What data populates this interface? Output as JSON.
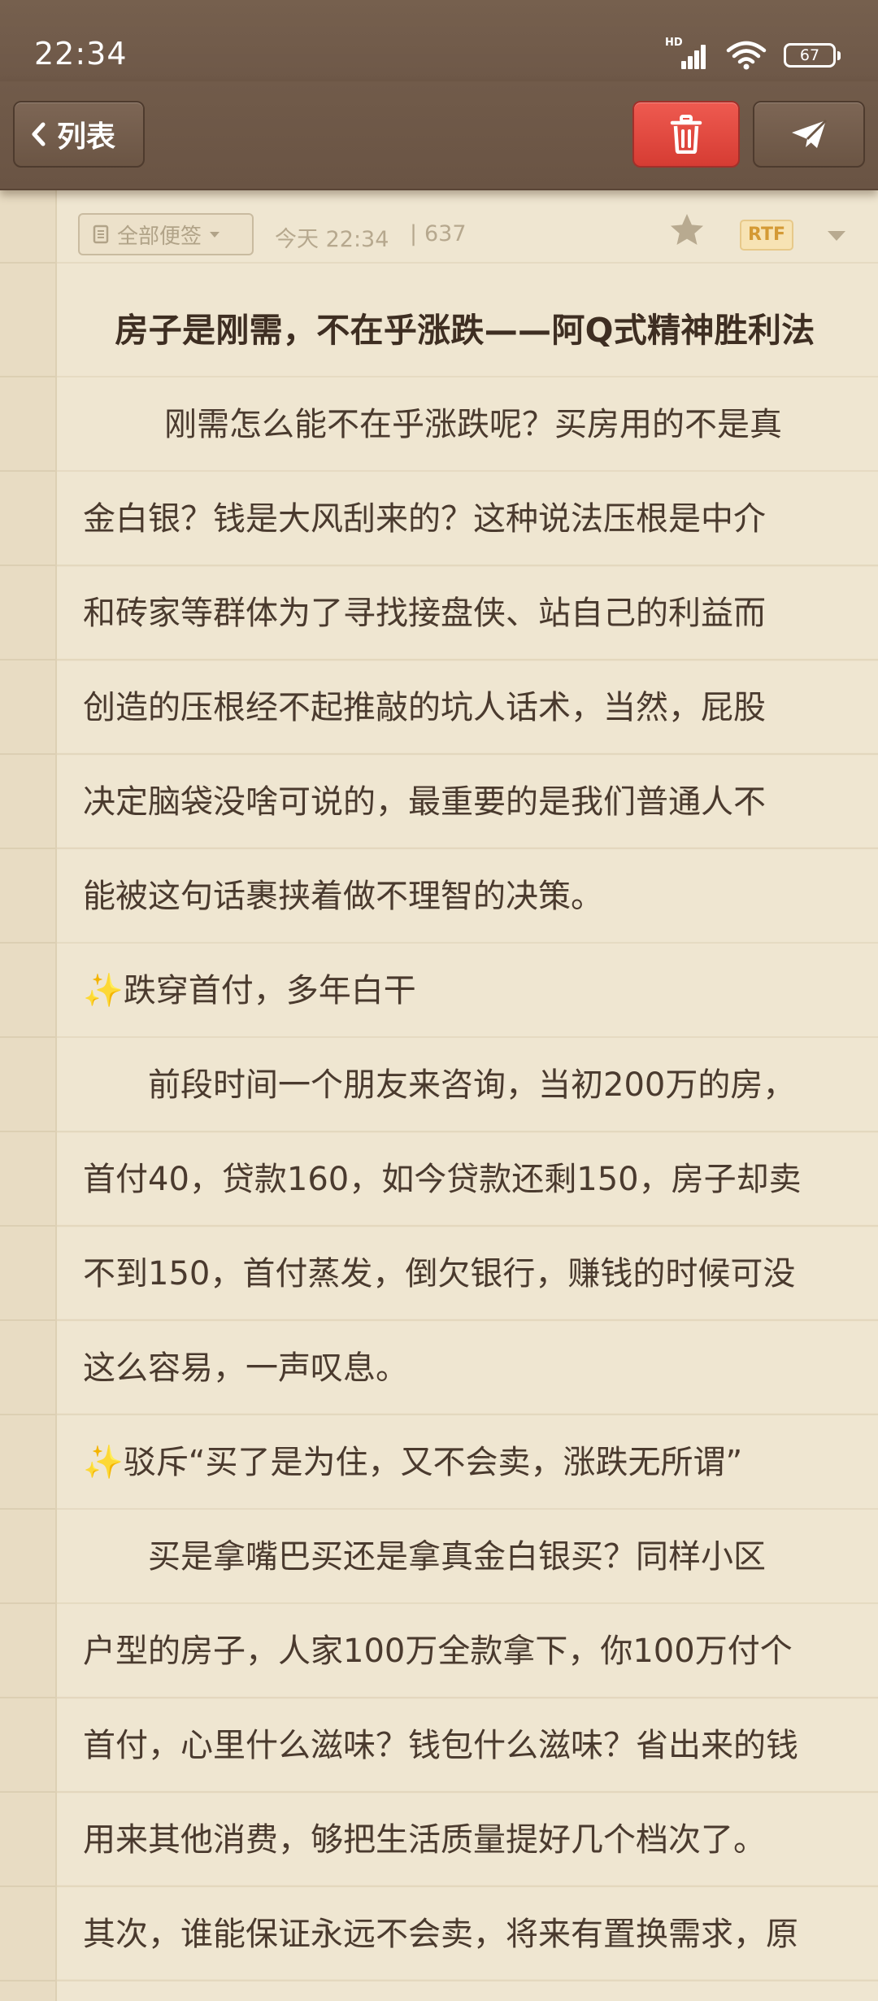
{
  "status_bar": {
    "time": "22:34",
    "network_label": "HD",
    "battery_level": "67",
    "icons": [
      "signal-icon",
      "wifi-icon",
      "battery-icon"
    ]
  },
  "toolbar": {
    "back_label": "列表",
    "icons": [
      "chevron-left-icon",
      "trash-icon",
      "send-icon"
    ],
    "accent_delete": "#e2473e"
  },
  "meta": {
    "folder_label": "全部便签",
    "date": "今天 22:34",
    "separator": "|",
    "char_count": "637",
    "format_badge": "RTF"
  },
  "note": {
    "title": "房子是刚需，不在乎涨跌——阿Q式精神胜利法",
    "lines": [
      "刚需怎么能不在乎涨跌呢？买房用的不是真",
      "金白银？钱是大风刮来的？这种说法压根是中介",
      "和砖家等群体为了寻找接盘侠、站自己的利益而",
      "创造的压根经不起推敲的坑人话术，当然，屁股",
      "决定脑袋没啥可说的，最重要的是我们普通人不",
      "能被这句话裹挟着做不理智的决策。",
      "跌穿首付，多年白干",
      "前段时间一个朋友来咨询，当初200万的房，",
      "首付40，贷款160，如今贷款还剩150，房子却卖",
      "不到150，首付蒸发，倒欠银行，赚钱的时候可没",
      "这么容易，一声叹息。",
      "驳斥“买了是为住，又不会卖，涨跌无所谓”",
      "买是拿嘴巴买还是拿真金白银买？同样小区",
      "户型的房子，人家100万全款拿下，你100万付个",
      "首付，心里什么滋味？钱包什么滋味？省出来的钱",
      "用来其他消费，够把生活质量提好几个档次了。",
      "其次，谁能保证永远不会卖，将来有置换需求，原"
    ],
    "sparkle_glyph": "✨"
  }
}
